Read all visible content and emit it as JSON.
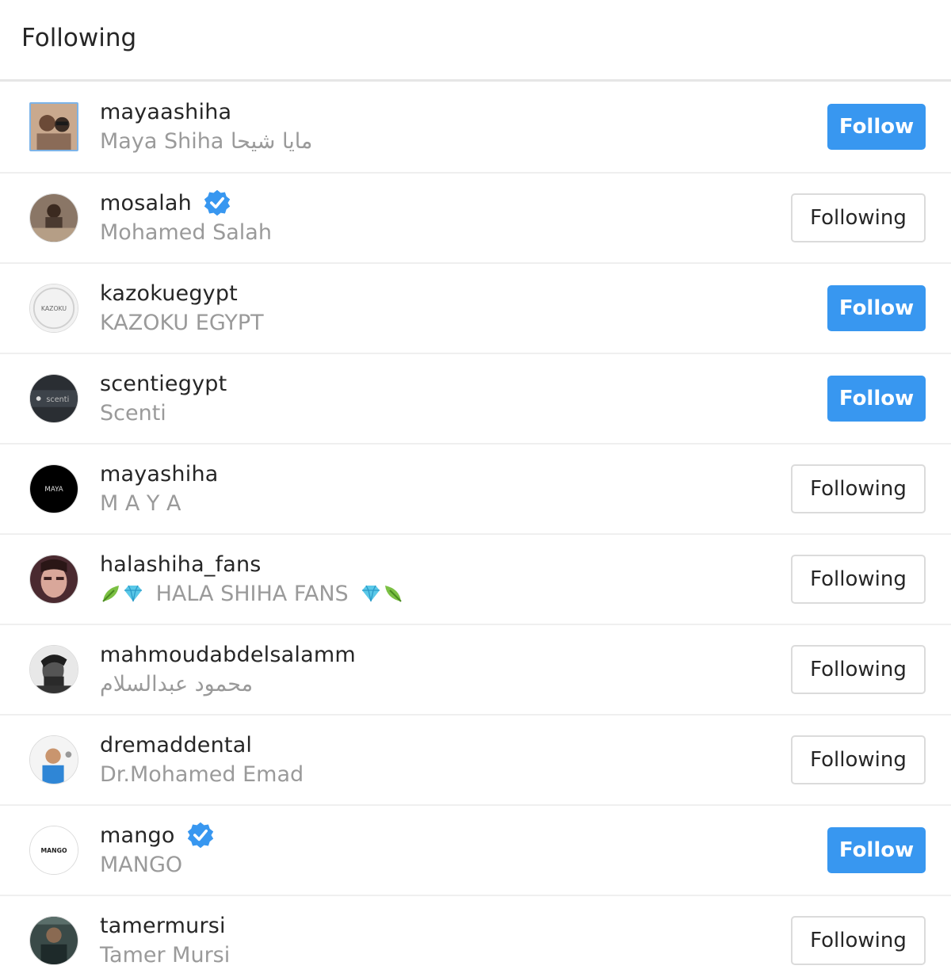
{
  "header": {
    "title": "Following"
  },
  "accounts": [
    {
      "username": "mayaashiha",
      "full_name": "Maya Shiha مايا شيحا",
      "verified": false,
      "button": "Follow"
    },
    {
      "username": "mosalah",
      "full_name": "Mohamed Salah",
      "verified": true,
      "button": "Following"
    },
    {
      "username": "kazokuegypt",
      "full_name": "KAZOKU EGYPT",
      "verified": false,
      "button": "Follow",
      "avatar_text": "KAZOKU"
    },
    {
      "username": "scentiegypt",
      "full_name": "Scenti",
      "verified": false,
      "button": "Follow",
      "avatar_text": "scenti"
    },
    {
      "username": "mayashiha",
      "full_name": "M A Y A",
      "verified": false,
      "button": "Following",
      "avatar_text": "MAYA"
    },
    {
      "username": "halashiha_fans",
      "full_name": "HALA SHIHA FANS",
      "verified": false,
      "button": "Following",
      "icons": [
        "leaf-icon",
        "diamond-icon"
      ]
    },
    {
      "username": "mahmoudabdelsalamm",
      "full_name": "محمود عبدالسلام",
      "verified": false,
      "button": "Following"
    },
    {
      "username": "dremaddental",
      "full_name": "Dr.Mohamed Emad",
      "verified": false,
      "button": "Following"
    },
    {
      "username": "mango",
      "full_name": "MANGO",
      "verified": true,
      "button": "Follow",
      "avatar_text": "MANGO"
    },
    {
      "username": "tamermursi",
      "full_name": "Tamer Mursi",
      "verified": false,
      "button": "Following"
    }
  ],
  "colors": {
    "follow_button": "#3897f0",
    "verified_badge": "#3897f0",
    "secondary_text": "#9a9a9a"
  }
}
